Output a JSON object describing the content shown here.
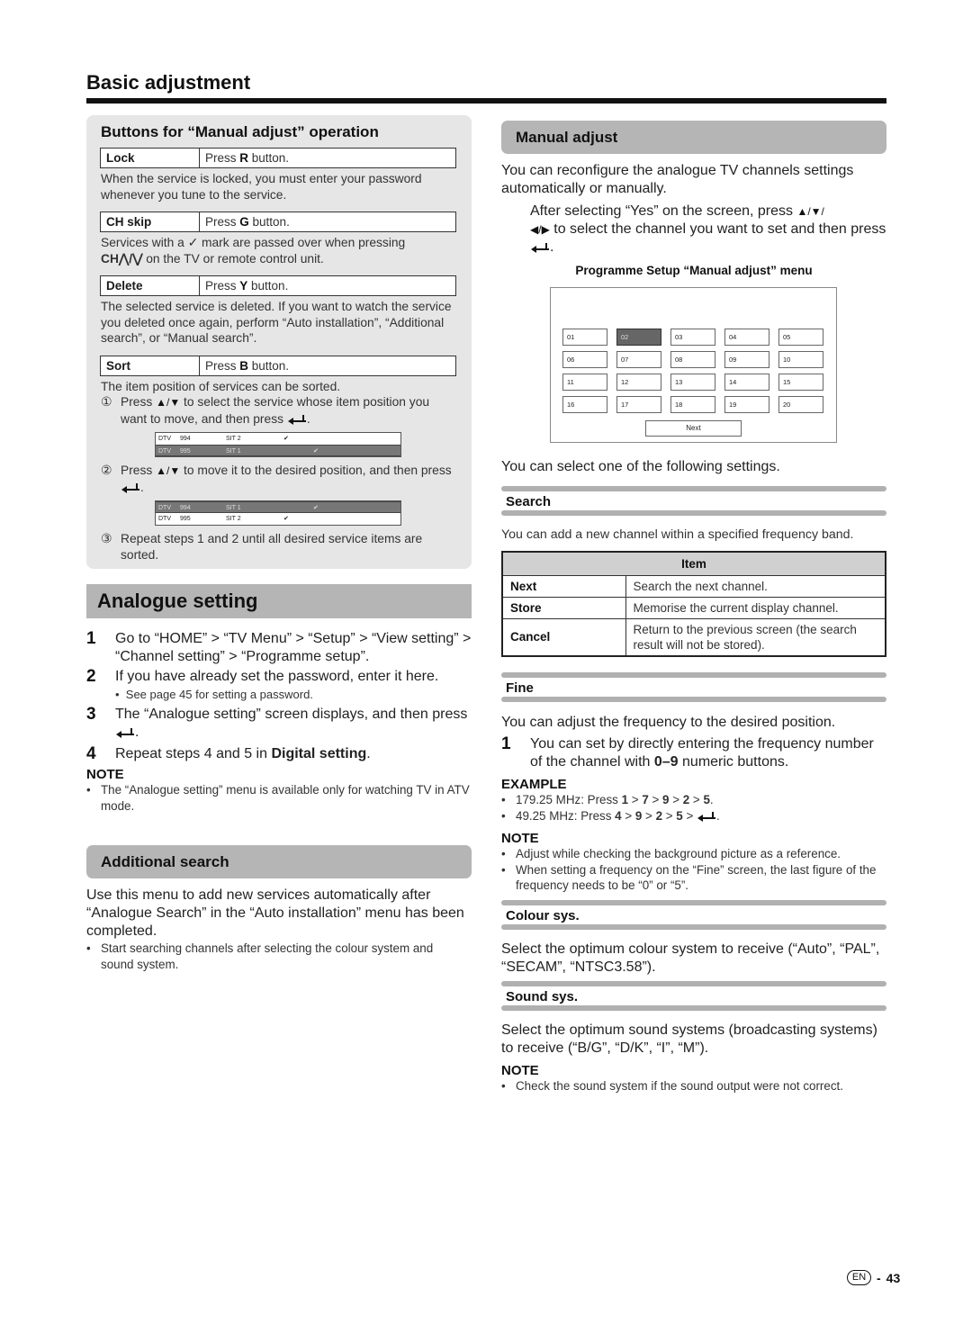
{
  "header": {
    "title": "Basic adjustment"
  },
  "buttons_box": {
    "title": "Buttons for “Manual adjust” operation",
    "lock": {
      "key": "Lock",
      "press": "Press ",
      "button": "R",
      "suffix": " button.",
      "desc": "When the service is locked, you must enter your password whenever you tune to the service."
    },
    "chskip": {
      "key": "CH skip",
      "press": "Press ",
      "button": "G",
      "suffix": " button.",
      "desc_a": "Services with a ✓ mark are passed over when pressing",
      "desc_ch": "CH⋀/⋁",
      "desc_b": " on the TV or remote control unit."
    },
    "delete": {
      "key": "Delete",
      "press": "Press ",
      "button": "Y",
      "suffix": " button.",
      "desc": "The selected service is deleted. If you want to watch the service you deleted once again, perform “Auto installation”, “Additional search”, or “Manual search”."
    },
    "sort": {
      "key": "Sort",
      "press": "Press ",
      "button": "B",
      "suffix": " button.",
      "desc": "The item position of services can be sorted.",
      "step1_num": "①",
      "step1_a": "Press ",
      "step1_arrows": "▲/▼",
      "step1_b": " to select the service whose item position you want to move, and then press ",
      "step2_num": "②",
      "step2_a": "Press ",
      "step2_arrows": "▲/▼",
      "step2_b": " to move it to the desired position, and then press ",
      "step3_num": "③",
      "step3": "Repeat steps 1 and 2 until all desired service items are sorted.",
      "list_before": [
        {
          "type": "DTV",
          "num": "994",
          "name": "SIT 2",
          "check1": "✔",
          "check2": "",
          "selected": false
        },
        {
          "type": "DTV",
          "num": "995",
          "name": "SIT 1",
          "check1": "",
          "check2": "✔",
          "selected": true
        }
      ],
      "list_after": [
        {
          "type": "DTV",
          "num": "994",
          "name": "SIT 1",
          "check1": "",
          "check2": "✔",
          "selected": true
        },
        {
          "type": "DTV",
          "num": "995",
          "name": "SIT 2",
          "check1": "✔",
          "check2": "",
          "selected": false
        }
      ]
    }
  },
  "analogue_setting": {
    "title": "Analogue setting",
    "steps": [
      {
        "num": "1",
        "text": "Go to “HOME” > “TV Menu” > “Setup” > “View setting” > “Channel setting” > “Programme setup”."
      },
      {
        "num": "2",
        "text": "If you have already set the password, enter it here.",
        "sub": "See page 45 for setting a password."
      },
      {
        "num": "3",
        "text": "The “Analogue setting” screen displays, and then press "
      },
      {
        "num": "4",
        "text_a": "Repeat steps 4 and 5 in ",
        "text_bold": "Digital setting",
        "text_b": "."
      }
    ],
    "note_label": "NOTE",
    "note": "The “Analogue setting” menu is available only for watching TV in ATV mode."
  },
  "additional_search": {
    "title": "Additional search",
    "body": "Use this menu to add new services automatically after “Analogue Search” in the “Auto installation” menu has been completed.",
    "bullet": "Start searching channels after selecting the colour system and sound system."
  },
  "manual_adjust": {
    "title": "Manual adjust",
    "intro": "You can reconfigure the analogue TV channels settings automatically or manually.",
    "instruction_a": "After selecting “Yes” on the screen, press ",
    "instruction_arrows1": "▲/▼/",
    "instruction_arrows2": "◀/▶",
    "instruction_b": " to select the channel you want to set and then press ",
    "figure_caption": "Programme Setup “Manual adjust” menu",
    "channels": [
      "01",
      "02",
      "03",
      "04",
      "05",
      "06",
      "07",
      "08",
      "09",
      "10",
      "11",
      "12",
      "13",
      "14",
      "15",
      "16",
      "17",
      "18",
      "19",
      "20"
    ],
    "selected_channel": "02",
    "next_button": "Next",
    "select_text": "You can select one of the following settings."
  },
  "search": {
    "title": "Search",
    "desc": "You can add a new channel within a specified frequency band.",
    "table_header": "Item",
    "rows": [
      {
        "key": "Next",
        "value": "Search the next channel."
      },
      {
        "key": "Store",
        "value": "Memorise the current display channel."
      },
      {
        "key": "Cancel",
        "value": "Return to the previous screen (the search result will not be stored)."
      }
    ]
  },
  "fine": {
    "title": "Fine",
    "desc": "You can adjust the frequency to the desired position.",
    "step_num": "1",
    "step_a": "You can set by directly entering the frequency number of the channel with ",
    "step_bold": "0–9",
    "step_b": " numeric buttons.",
    "example_label": "EXAMPLE",
    "example1_a": "179.25 MHz: Press ",
    "example1_seq": [
      "1",
      "7",
      "9",
      "2",
      "5"
    ],
    "example2_a": "49.25 MHz: Press ",
    "example2_seq": [
      "4",
      "9",
      "2",
      "5"
    ],
    "note_label": "NOTE",
    "notes": [
      "Adjust while checking the background picture as a reference.",
      "When setting a frequency on the “Fine” screen, the last figure of the frequency needs to be “0” or “5”."
    ]
  },
  "colour_sys": {
    "title": "Colour sys.",
    "desc": "Select the optimum colour system to receive (“Auto”, “PAL”, “SECAM”, “NTSC3.58”)."
  },
  "sound_sys": {
    "title": "Sound sys.",
    "desc": "Select the optimum sound systems (broadcasting systems) to receive (“B/G”, “D/K”, “I”, “M”).",
    "note_label": "NOTE",
    "note": "Check the sound system if the sound output were not correct."
  },
  "footer": {
    "lang": "EN",
    "sep": "-",
    "page": "43"
  }
}
